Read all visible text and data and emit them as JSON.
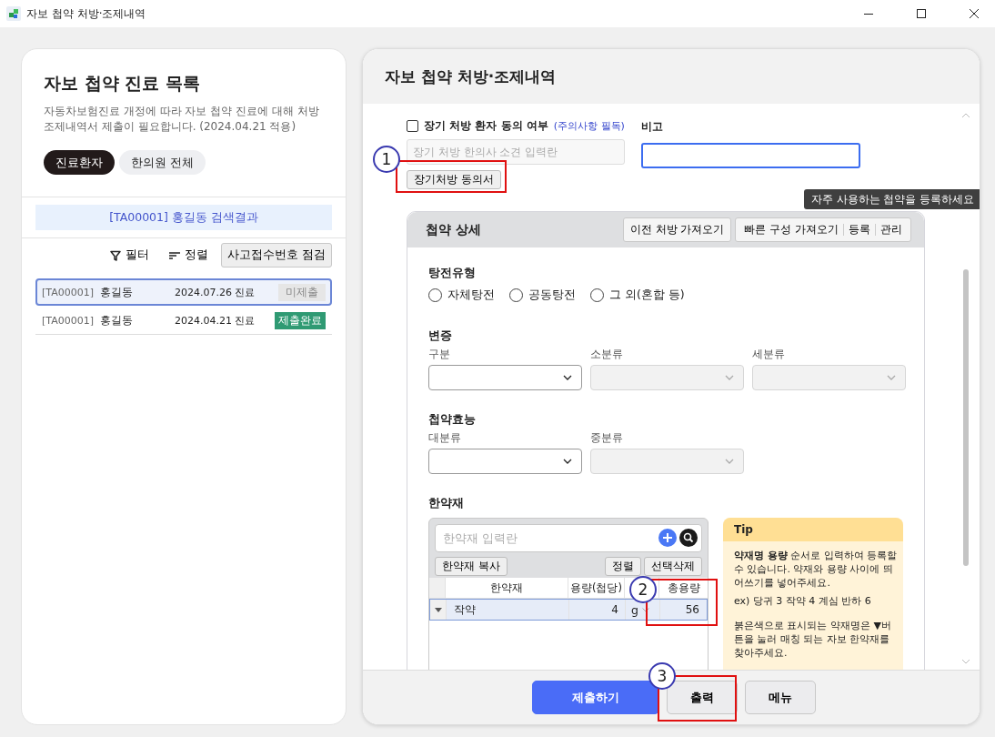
{
  "window": {
    "title": "자보 첩약 처방·조제내역"
  },
  "left_panel": {
    "title": "자보 첩약 진료 목록",
    "description": "자동차보험진료 개정에 따라 자보 첩약 진료에 대해 처방 조제내역서 제출이 필요합니다. (2024.04.21 적용)",
    "tabs": [
      {
        "label": "진료환자",
        "selected": true
      },
      {
        "label": "한의원 전체",
        "selected": false
      }
    ],
    "search_result": "[TA00001] 홍길동  검색결과",
    "toolbar": {
      "filter": "필터",
      "sort": "정렬",
      "check_button": "사고접수번호 점검"
    },
    "records": [
      {
        "code": "[TA00001]",
        "name": "홍길동",
        "date": "2024.07.26 진료",
        "status": "미제출",
        "submitted": false,
        "selected": true
      },
      {
        "code": "[TA00001]",
        "name": "홍길동",
        "date": "2024.04.21 진료",
        "status": "제출완료",
        "submitted": true,
        "selected": false
      }
    ]
  },
  "right_panel": {
    "title": "자보 첩약 처방·조제내역",
    "consent": {
      "label": "장기 처방 환자 동의 여부",
      "note": "(주의사항 필독)",
      "checked": false,
      "placeholder": "장기 처방 한의사 소견 입력란",
      "button": "장기처방 동의서"
    },
    "remark": {
      "label": "비고",
      "focused": true
    },
    "tooltip": "자주 사용하는 첩약을 등록하세요",
    "detail": {
      "title": "첩약 상세",
      "previous_button": "이전 처방 가져오기",
      "quick_buttons": [
        "빠른 구성 가져오기",
        "등록",
        "관리"
      ],
      "decoction": {
        "label": "탕전유형",
        "options": [
          {
            "label": "자체탕전",
            "selected": false
          },
          {
            "label": "공동탕전",
            "selected": false
          },
          {
            "label": "그 외(혼합 등)",
            "selected": false
          }
        ]
      },
      "pattern": {
        "label": "변증",
        "selects": [
          {
            "label": "구분",
            "disabled": false
          },
          {
            "label": "소분류",
            "disabled": true
          },
          {
            "label": "세분류",
            "disabled": true
          }
        ]
      },
      "efficacy": {
        "label": "첩약효능",
        "selects": [
          {
            "label": "대분류",
            "disabled": false
          },
          {
            "label": "중분류",
            "disabled": true
          }
        ]
      },
      "herbs": {
        "label": "한약재",
        "placeholder": "한약재 입력란",
        "copy_button": "한약재 복사",
        "sort_button": "정렬",
        "delete_button": "선택삭제",
        "columns": [
          "한약재",
          "용량(첩당)",
          "총용량"
        ],
        "rows": [
          {
            "name": "작약",
            "dose": "4",
            "unit": "g",
            "total": "56",
            "selected": true
          }
        ]
      },
      "tip": {
        "title": "Tip",
        "paragraphs": [
          "**약재명 용량** 순서로 입력하여 등록할 수 있습니다. 약재와 용량 사이에 띄어쓰기를 넣어주세요.",
          "ex) 당귀 3 작약 4 계심 반하 6",
          "붉은색으로 표시되는 약재명은 ▼버튼을 눌러 매칭 되는 자보 한약재를 찾아주세요."
        ]
      }
    },
    "footer": {
      "buttons": [
        {
          "label": "제출하기",
          "kind": "primary"
        },
        {
          "label": "출력",
          "kind": "plain"
        },
        {
          "label": "메뉴",
          "kind": "plain"
        }
      ]
    }
  },
  "annotations": [
    {
      "number": "1"
    },
    {
      "number": "2"
    },
    {
      "number": "3"
    }
  ]
}
